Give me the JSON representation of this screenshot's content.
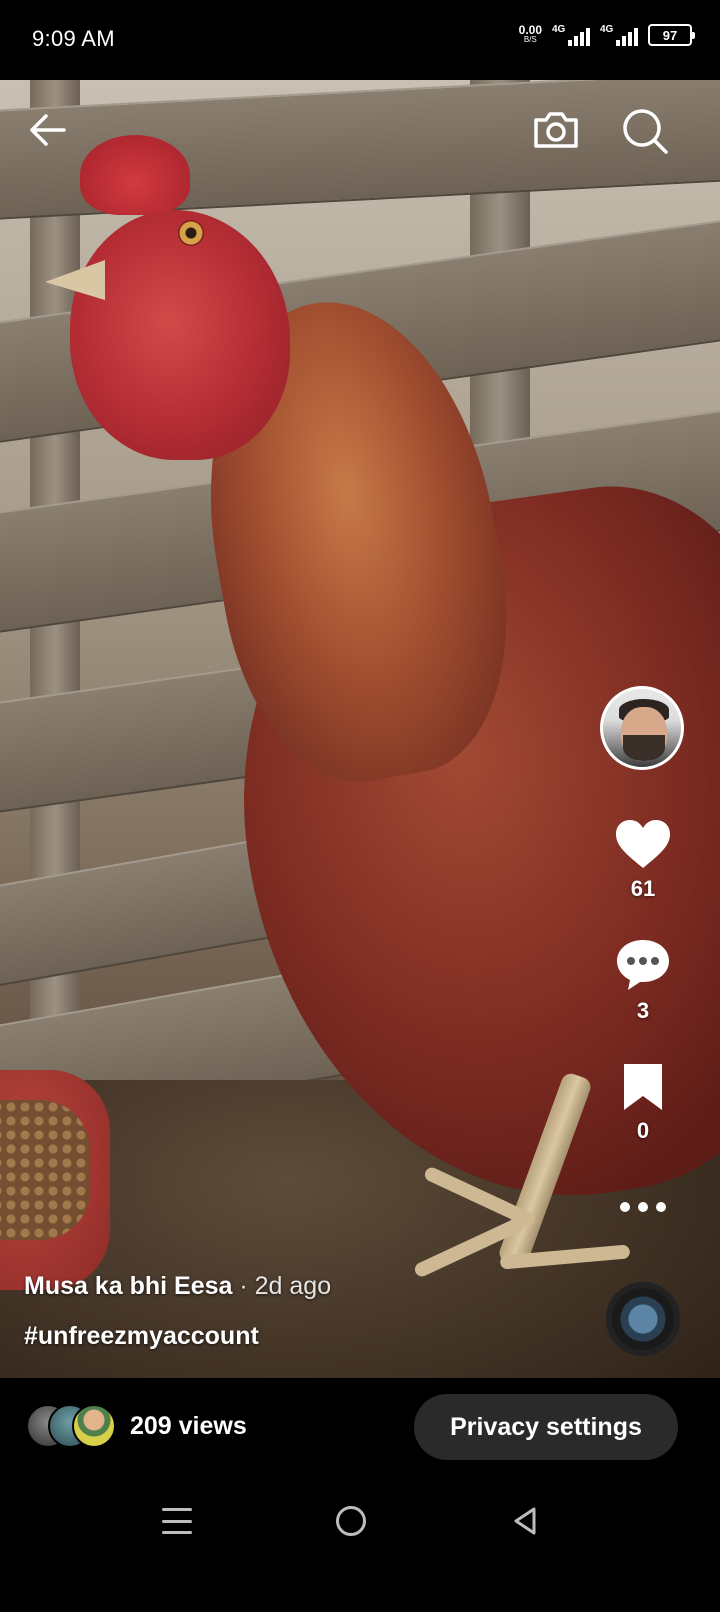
{
  "status_bar": {
    "time": "9:09 AM",
    "net_speed_value": "0.00",
    "net_speed_unit": "B/S",
    "signal_1_label": "4G",
    "signal_2_label": "4G",
    "battery": "97"
  },
  "top_bar": {
    "back_icon": "arrow-left-icon",
    "camera_icon": "camera-icon",
    "search_icon": "search-icon"
  },
  "actions": {
    "likes": "61",
    "comments": "3",
    "saves": "0"
  },
  "caption": {
    "username": "Musa ka bhi Eesa",
    "time": " · 2d ago",
    "hashtag": "#unfreezmyaccount"
  },
  "bottom": {
    "views": "209 views",
    "privacy_button": "Privacy settings"
  },
  "colors": {
    "background": "#000000",
    "button_bg": "#2a2a2a",
    "text": "#ffffff"
  }
}
